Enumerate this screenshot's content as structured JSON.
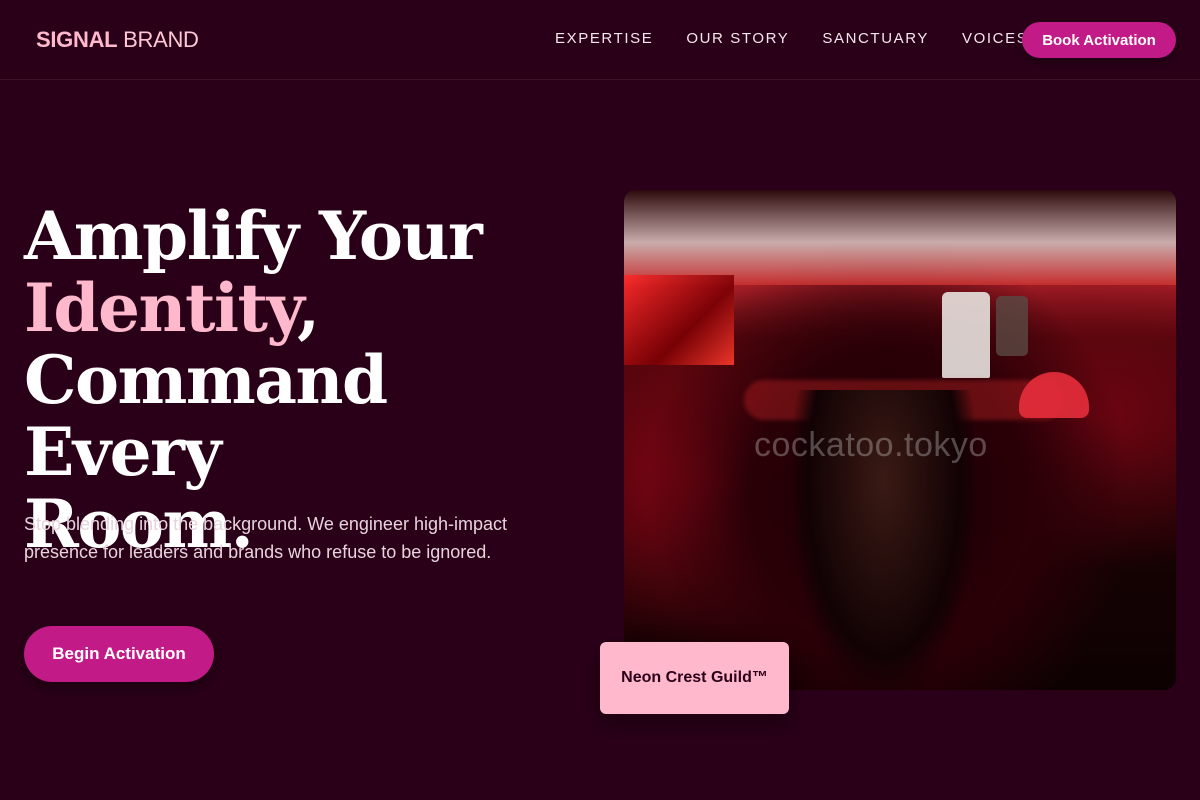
{
  "brand": {
    "part1": "SIGNAL",
    "part2": "BRAND"
  },
  "nav": {
    "links": [
      "EXPERTISE",
      "OUR STORY",
      "SANCTUARY",
      "VOICES"
    ],
    "cta": "Book Activation"
  },
  "hero": {
    "headline_1": "Amplify Your",
    "headline_highlight": "Identity",
    "headline_comma": ",",
    "headline_2": "Command Every",
    "headline_3": "Room.",
    "lede": "Stop blending into the background. We engineer high-impact presence for leaders and brands who refuse to be ignored.",
    "cta": "Begin Activation"
  },
  "photo": {
    "watermark": "cockatoo.tokyo"
  },
  "badge": {
    "label": "Neon Crest Guild™"
  },
  "colors": {
    "background": "#2a0018",
    "accent": "#c21a86",
    "pink": "#ffb8cc"
  }
}
